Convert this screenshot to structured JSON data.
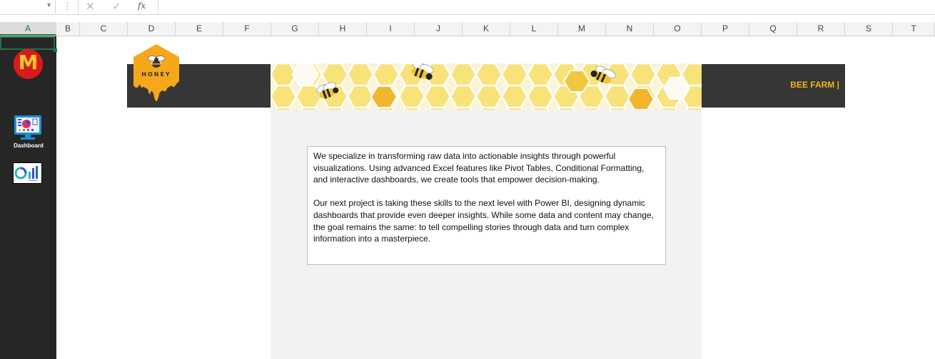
{
  "formula_bar": {
    "name_box": "",
    "cancel_icon": "close-icon",
    "enter_icon": "check-icon",
    "function_label": "fx",
    "formula": ""
  },
  "columns": [
    "A",
    "B",
    "C",
    "D",
    "E",
    "F",
    "G",
    "H",
    "I",
    "J",
    "K",
    "L",
    "M",
    "N",
    "O",
    "P",
    "Q",
    "R",
    "S",
    "T"
  ],
  "active_column": "A",
  "sidebar": {
    "logo_letter": "M",
    "dashboard_label": "Dashboard",
    "colors": {
      "background": "#262626",
      "logo": "#da1a1a",
      "logo_letter": "#ffc72c"
    }
  },
  "banner": {
    "logo_text": "HONEY",
    "brand": "BEE FARM |",
    "colors": {
      "dark": "#363636",
      "accent": "#f3b31c",
      "honey": "#f5a81c"
    }
  },
  "textbox": {
    "paragraph1": "We specialize in transforming raw data into actionable insights through powerful visualizations. Using advanced Excel features like Pivot Tables, Conditional Formatting, and interactive dashboards, we create tools that empower decision-making.",
    "paragraph2": "Our next project is taking these skills to the next level with Power BI, designing dynamic dashboards that provide even deeper insights. While some data and content may change, the goal remains the same: to tell compelling stories through data and turn complex information into a masterpiece."
  }
}
